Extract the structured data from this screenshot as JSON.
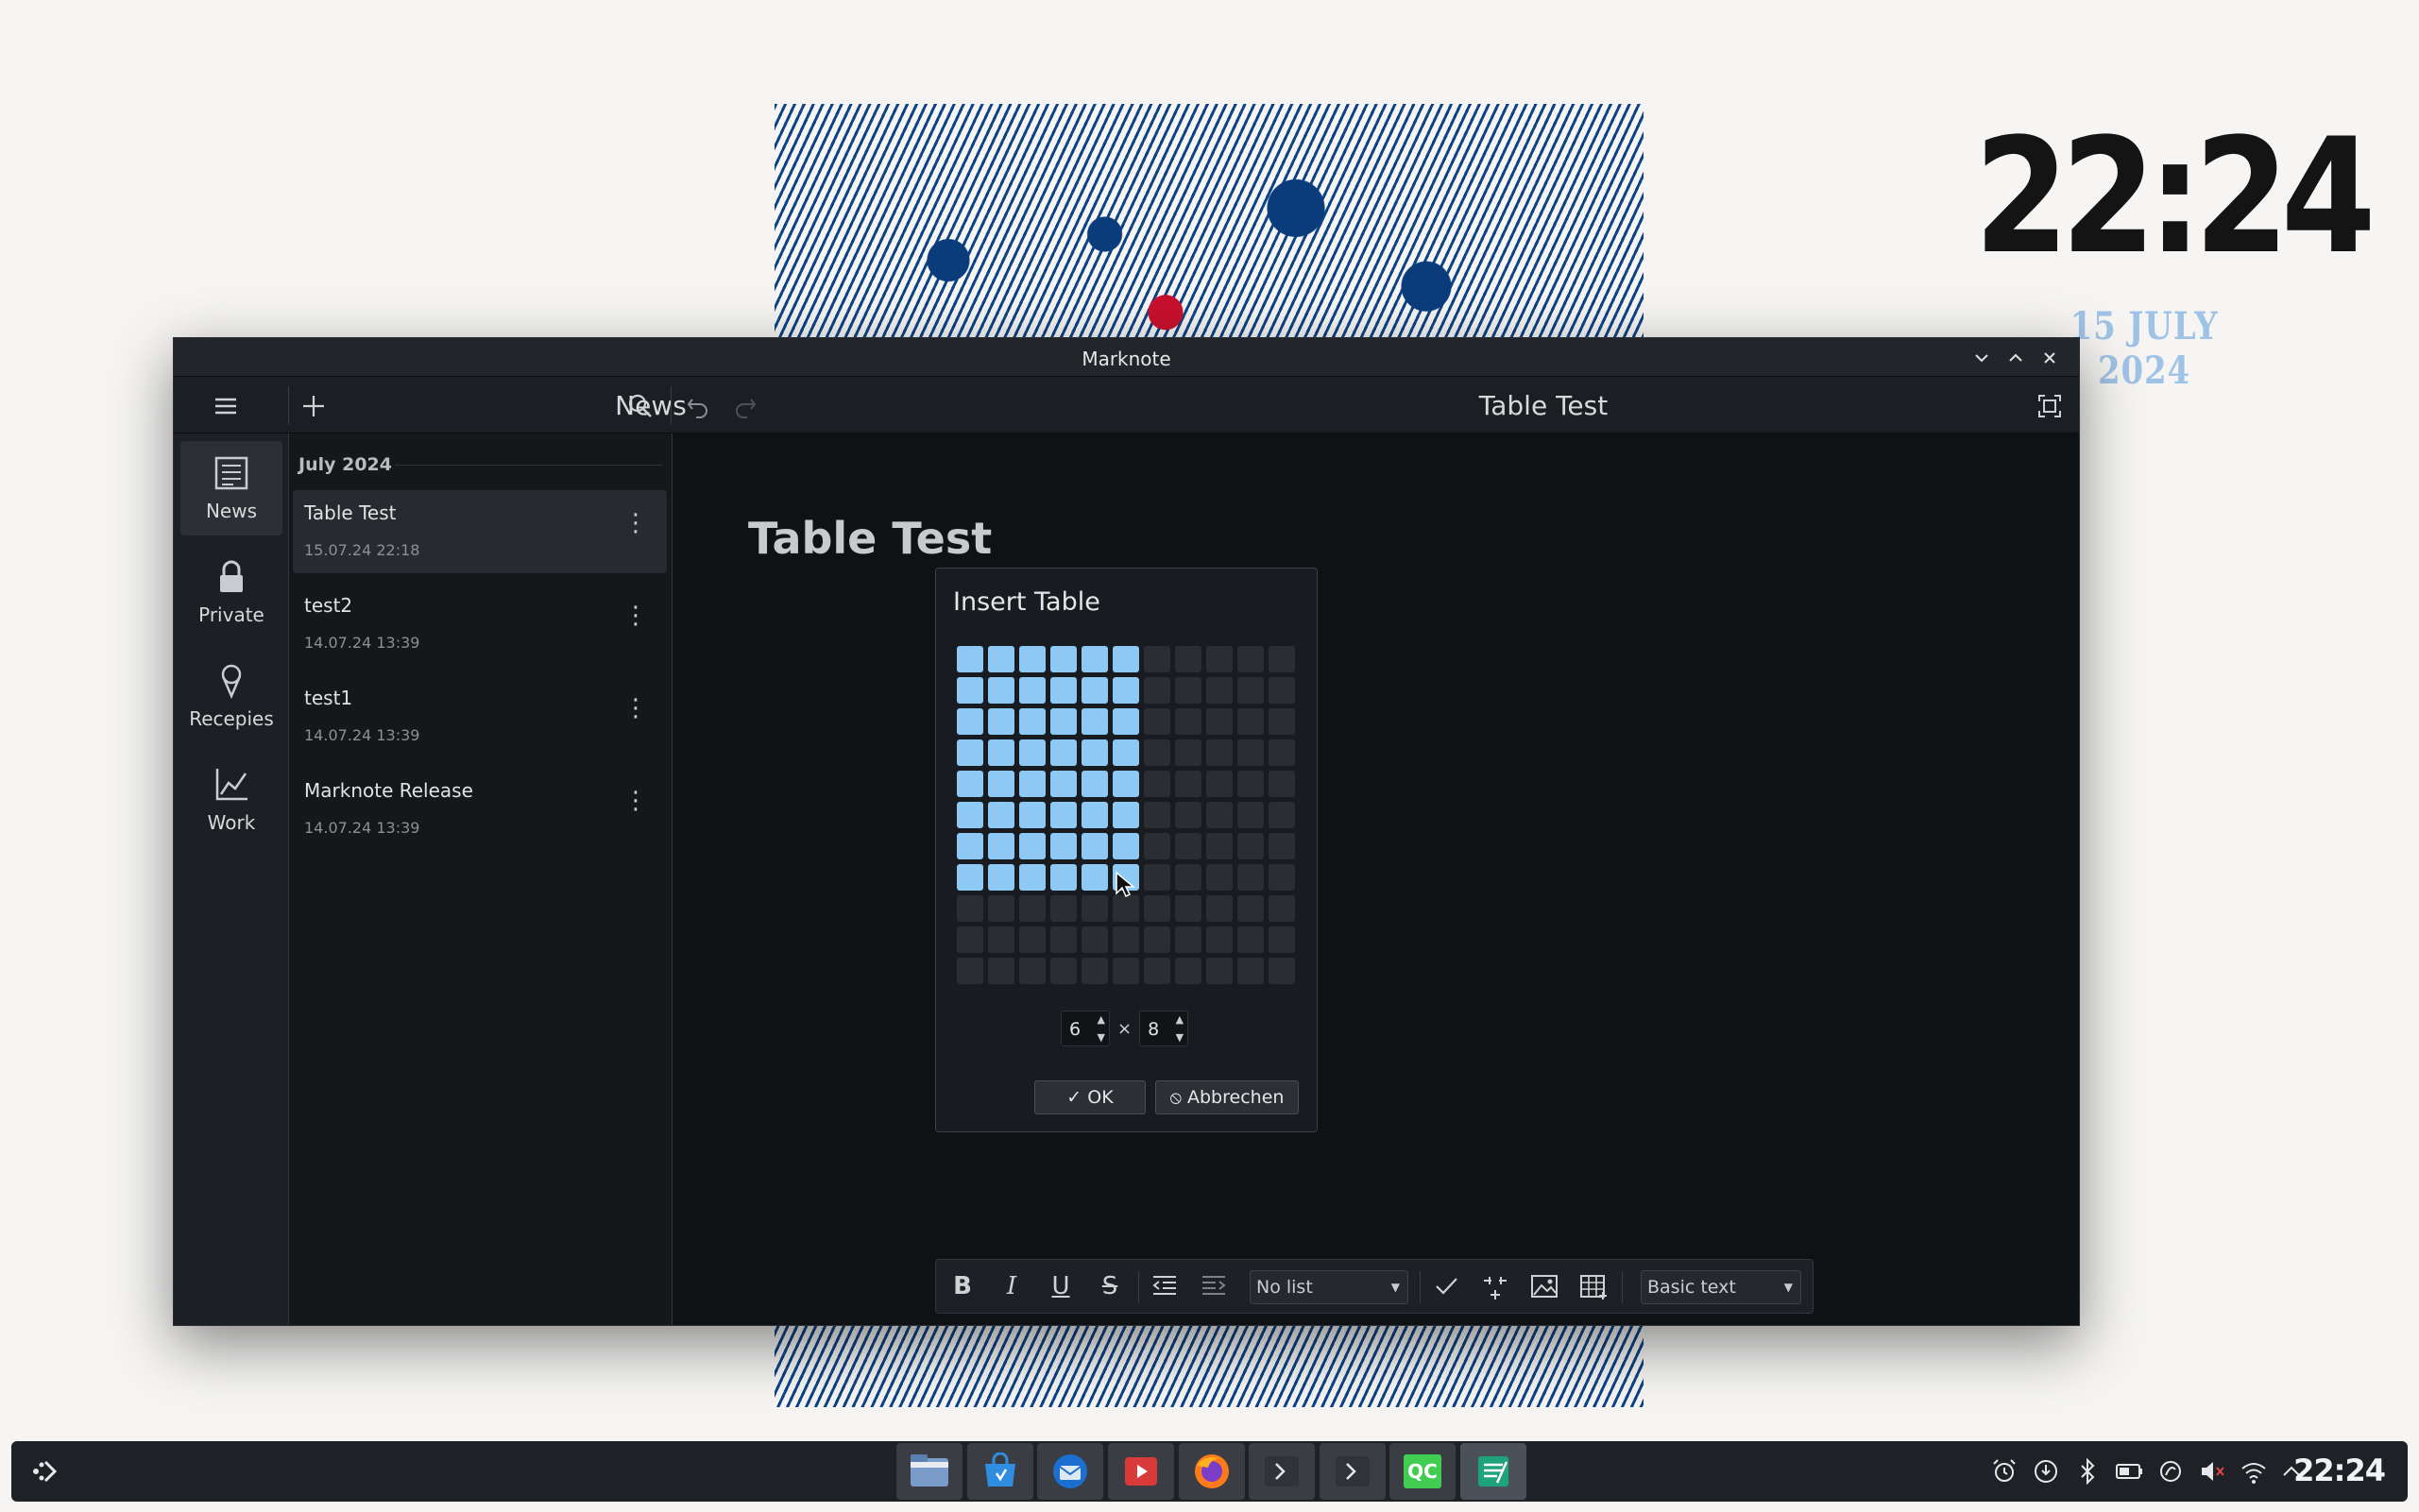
{
  "desktop": {
    "clock_time": "22:24",
    "clock_date": "15 JULY 2024"
  },
  "window": {
    "title": "Marknote",
    "controls": [
      "minimize",
      "maximize",
      "close"
    ]
  },
  "toolbar": {
    "notebook_title": "News",
    "note_title": "Table Test",
    "buttons": [
      "menu-icon",
      "add-icon",
      "search-icon",
      "undo-icon",
      "redo-icon",
      "fullscreen-icon"
    ]
  },
  "sidebar": {
    "items": [
      {
        "label": "News",
        "icon": "newspaper-icon",
        "active": true
      },
      {
        "label": "Private",
        "icon": "lock-icon",
        "active": false
      },
      {
        "label": "Recepies",
        "icon": "icecream-icon",
        "active": false
      },
      {
        "label": "Work",
        "icon": "chart-icon",
        "active": false
      }
    ]
  },
  "notelist": {
    "month": "July 2024",
    "notes": [
      {
        "title": "Table Test",
        "date": "15.07.24 22:18",
        "active": true
      },
      {
        "title": "test2",
        "date": "14.07.24 13:39",
        "active": false
      },
      {
        "title": "test1",
        "date": "14.07.24 13:39",
        "active": false
      },
      {
        "title": "Marknote Release",
        "date": "14.07.24 13:39",
        "active": false
      }
    ]
  },
  "editor": {
    "heading": "Table Test"
  },
  "dialog": {
    "title": "Insert Table",
    "grid_columns": 11,
    "grid_rows": 11,
    "selected_columns": 6,
    "selected_rows": 8,
    "columns_value": "6",
    "rows_value": "8",
    "times": "×",
    "ok_label": "OK",
    "cancel_label": "Abbrechen"
  },
  "formatbar": {
    "list_style": "No list",
    "text_style": "Basic text"
  },
  "taskbar": {
    "clock": "22:24",
    "apps": [
      {
        "name": "file-manager-icon",
        "state": "running"
      },
      {
        "name": "software-store-icon",
        "state": "running"
      },
      {
        "name": "thunderbird-icon",
        "state": "running"
      },
      {
        "name": "media-player-icon",
        "state": "running"
      },
      {
        "name": "firefox-icon",
        "state": "running"
      },
      {
        "name": "terminal-icon",
        "state": "running"
      },
      {
        "name": "terminal-icon",
        "state": "running"
      },
      {
        "name": "qt-creator-icon",
        "state": "running"
      },
      {
        "name": "marknote-icon",
        "state": "active"
      }
    ],
    "qt_label": "QC"
  },
  "colors": {
    "accent": "#8ec8f4",
    "window_bg": "#101317",
    "wallpaper_blue": "#0d4488",
    "wallpaper_red": "#c8102e"
  }
}
